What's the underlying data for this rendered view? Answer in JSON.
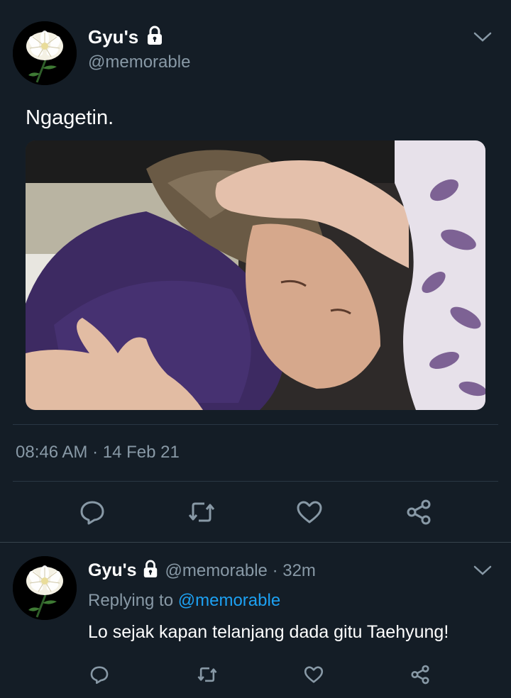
{
  "main_tweet": {
    "display_name": "Gyu's",
    "handle": "@memorable",
    "text": "Ngagetin.",
    "timestamp": "08:46 AM · 14 Feb 21"
  },
  "reply_tweet": {
    "display_name": "Gyu's",
    "handle_time": "@memorable · 32m",
    "replying_prefix": "Replying to",
    "replying_handle": "@memorable",
    "text": "Lo sejak kapan telanjang dada gitu Taehyung!"
  },
  "colors": {
    "background": "#141d26",
    "muted": "#8899a6",
    "link": "#1da1f2"
  },
  "icons": [
    "lock-icon",
    "chevron-down-icon",
    "reply-icon",
    "retweet-icon",
    "like-icon",
    "share-icon"
  ]
}
